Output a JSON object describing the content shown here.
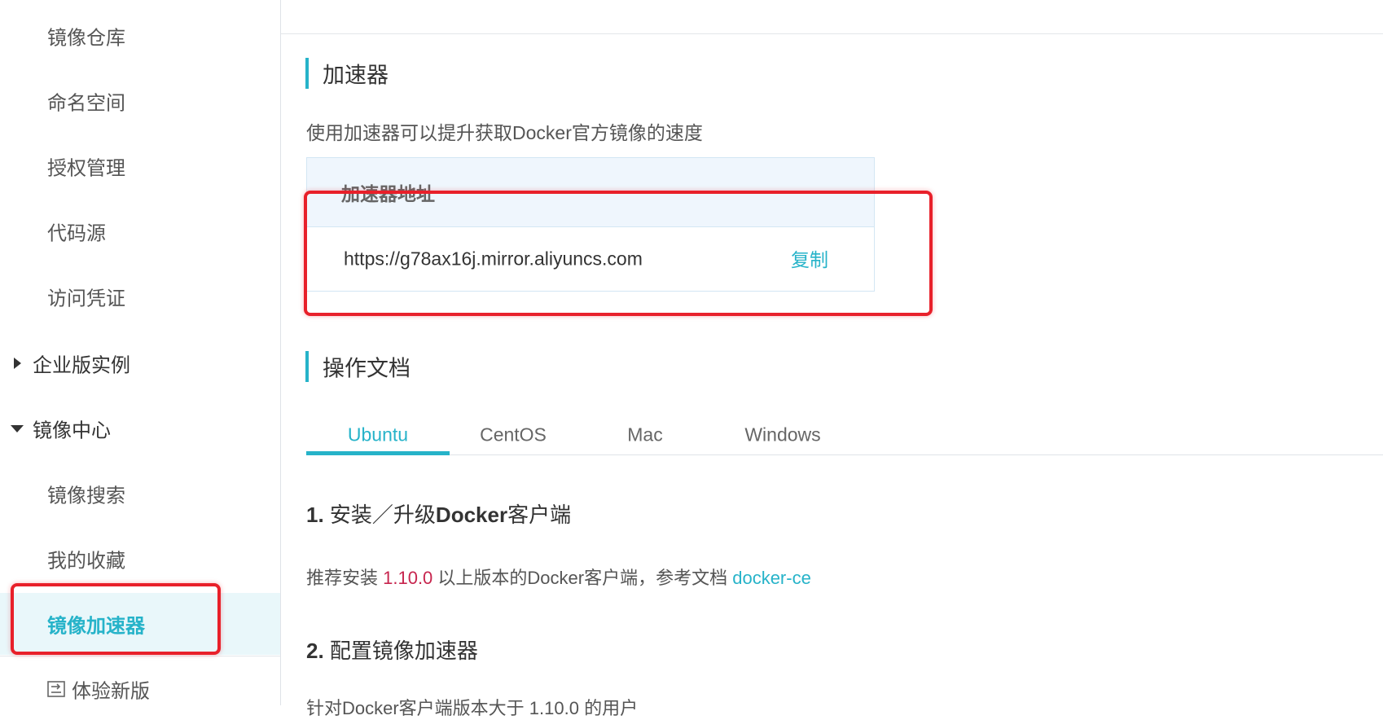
{
  "sidebar": {
    "items": [
      {
        "label": "镜像仓库"
      },
      {
        "label": "命名空间"
      },
      {
        "label": "授权管理"
      },
      {
        "label": "代码源"
      },
      {
        "label": "访问凭证"
      }
    ],
    "enterprise_group": "企业版实例",
    "mirror_group": "镜像中心",
    "mirror_items": [
      {
        "label": "镜像搜索"
      },
      {
        "label": "我的收藏"
      },
      {
        "label": "镜像加速器"
      }
    ],
    "new_version": "体验新版"
  },
  "accelerator": {
    "title": "加速器",
    "description": "使用加速器可以提升获取Docker官方镜像的速度",
    "address_header": "加速器地址",
    "address": "https://g78ax16j.mirror.aliyuncs.com",
    "copy_label": "复制"
  },
  "docs": {
    "title": "操作文档",
    "tabs": [
      {
        "label": "Ubuntu"
      },
      {
        "label": "CentOS"
      },
      {
        "label": "Mac"
      },
      {
        "label": "Windows"
      }
    ],
    "step1": {
      "num": "1.",
      "text1": " 安装／升级",
      "bold": "Docker",
      "text2": "客户端"
    },
    "step1_para": {
      "prefix": "推荐安装 ",
      "version": "1.10.0",
      "middle": " 以上版本的Docker客户端，参考文档 ",
      "link": "docker-ce"
    },
    "step2": {
      "num": "2.",
      "text": " 配置镜像加速器"
    },
    "step2_para": "针对Docker客户端版本大于 1.10.0 的用户"
  },
  "colors": {
    "accent": "#26b3c9",
    "highlight": "#e8202a",
    "version": "#c7254e"
  }
}
